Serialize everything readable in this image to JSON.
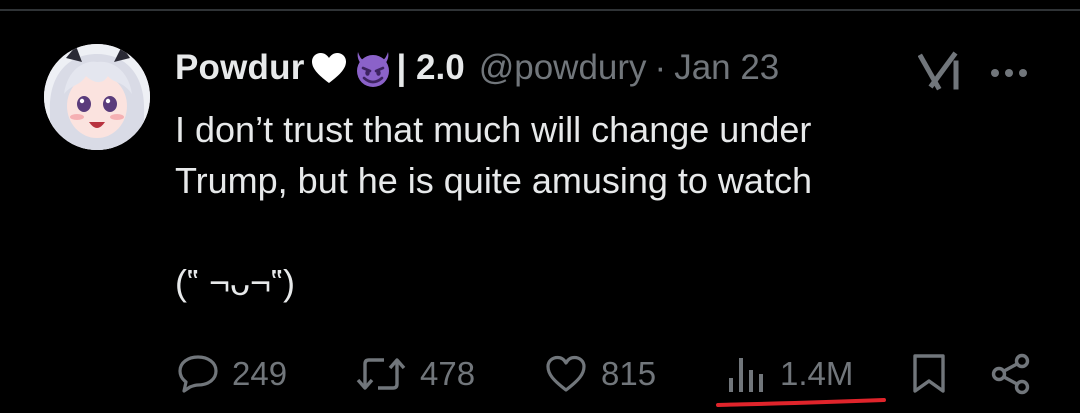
{
  "tweet": {
    "author": {
      "display_name": "Powdur",
      "name_suffix": "| 2.0",
      "handle": "@powdury",
      "emojis": [
        "white-heart-icon",
        "smiling-devil-icon"
      ]
    },
    "separator": "·",
    "date": "Jan 23",
    "text": "I don’t trust that much will change under\nTrump, but he is quite amusing to watch\n\n(‟ ¬ᴗ¬‟)"
  },
  "actions": {
    "replies": "249",
    "reposts": "478",
    "likes": "815",
    "views": "1.4M"
  },
  "colors": {
    "background": "#000000",
    "text_primary": "#e7e9ea",
    "text_secondary": "#71767b",
    "divider": "#2f3336",
    "devil_purple": "#8b62c9",
    "annotation_red": "#e0242b"
  },
  "icons": {
    "header_right": [
      "grok-icon",
      "more-icon"
    ],
    "actions": [
      "reply-icon",
      "repost-icon",
      "like-icon",
      "views-icon",
      "bookmark-icon",
      "share-icon"
    ]
  }
}
